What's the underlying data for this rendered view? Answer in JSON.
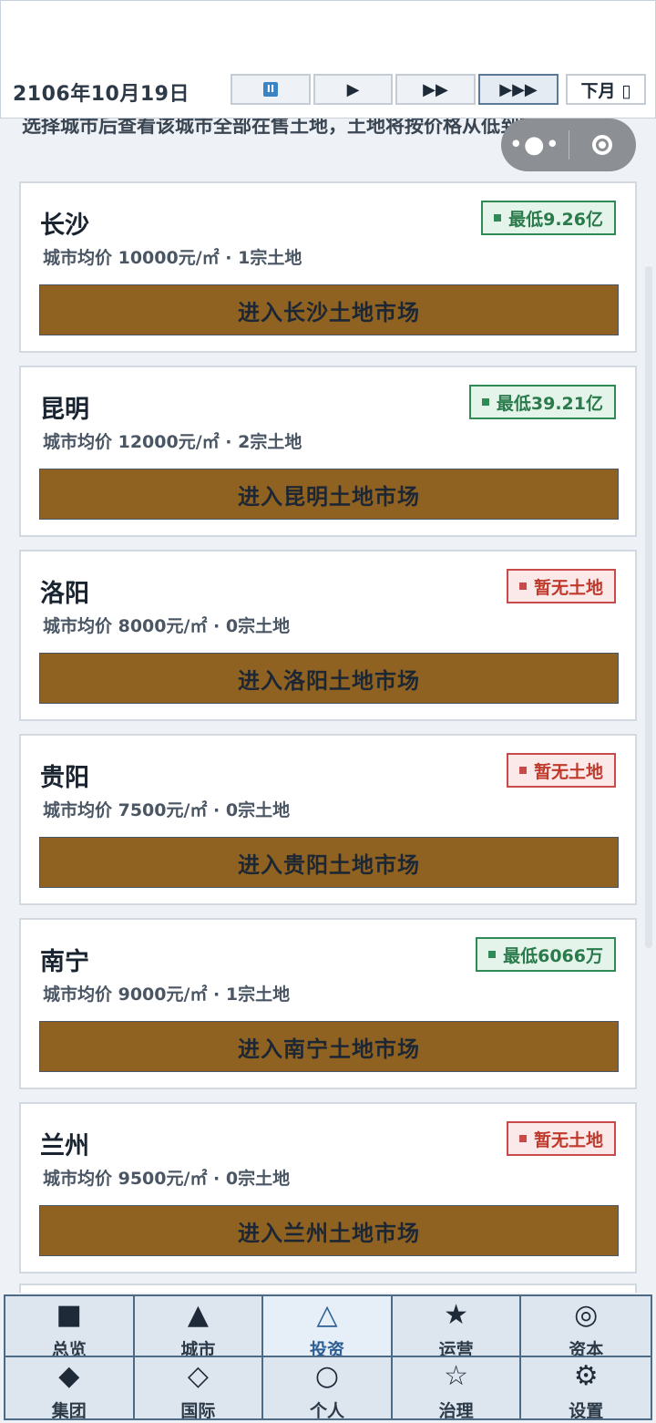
{
  "header": {
    "date": "2106年10月19日",
    "speed_buttons": [
      {
        "name": "pause",
        "glyph": "II"
      },
      {
        "name": "play",
        "glyph": "▶"
      },
      {
        "name": "fast",
        "glyph": "▶▶"
      },
      {
        "name": "fastest",
        "glyph": "▶▶▶"
      }
    ],
    "next_month_label": "下月 ▯"
  },
  "intro_text": "选择城市后查看该城市全部在售土地，土地将按价格从低到高排列。",
  "capsule": {
    "menu_glyph": "•●•"
  },
  "cities": [
    {
      "name": "长沙",
      "info": "城市均价 10000元/㎡ · 1宗土地",
      "badge": "最低9.26亿",
      "badge_type": "green",
      "button": "进入长沙土地市场"
    },
    {
      "name": "昆明",
      "info": "城市均价 12000元/㎡ · 2宗土地",
      "badge": "最低39.21亿",
      "badge_type": "green",
      "button": "进入昆明土地市场"
    },
    {
      "name": "洛阳",
      "info": "城市均价 8000元/㎡ · 0宗土地",
      "badge": "暂无土地",
      "badge_type": "red",
      "button": "进入洛阳土地市场"
    },
    {
      "name": "贵阳",
      "info": "城市均价 7500元/㎡ · 0宗土地",
      "badge": "暂无土地",
      "badge_type": "red",
      "button": "进入贵阳土地市场"
    },
    {
      "name": "南宁",
      "info": "城市均价 9000元/㎡ · 1宗土地",
      "badge": "最低6066万",
      "badge_type": "green",
      "button": "进入南宁土地市场"
    },
    {
      "name": "兰州",
      "info": "城市均价 9500元/㎡ · 0宗土地",
      "badge": "暂无土地",
      "badge_type": "red",
      "button": "进入兰州土地市场"
    }
  ],
  "nav": [
    {
      "label": "总览",
      "icon": "■"
    },
    {
      "label": "城市",
      "icon": "▲"
    },
    {
      "label": "投资",
      "icon": "△"
    },
    {
      "label": "运营",
      "icon": "★"
    },
    {
      "label": "资本",
      "icon": "◎"
    },
    {
      "label": "集团",
      "icon": "◆"
    },
    {
      "label": "国际",
      "icon": "◇"
    },
    {
      "label": "个人",
      "icon": "○"
    },
    {
      "label": "治理",
      "icon": "☆"
    },
    {
      "label": "设置",
      "icon": "⚙"
    }
  ],
  "colors": {
    "accent": "#8f6222",
    "green": "#2f8a55",
    "red": "#c94a4a",
    "nav_border": "#4d6a86"
  }
}
